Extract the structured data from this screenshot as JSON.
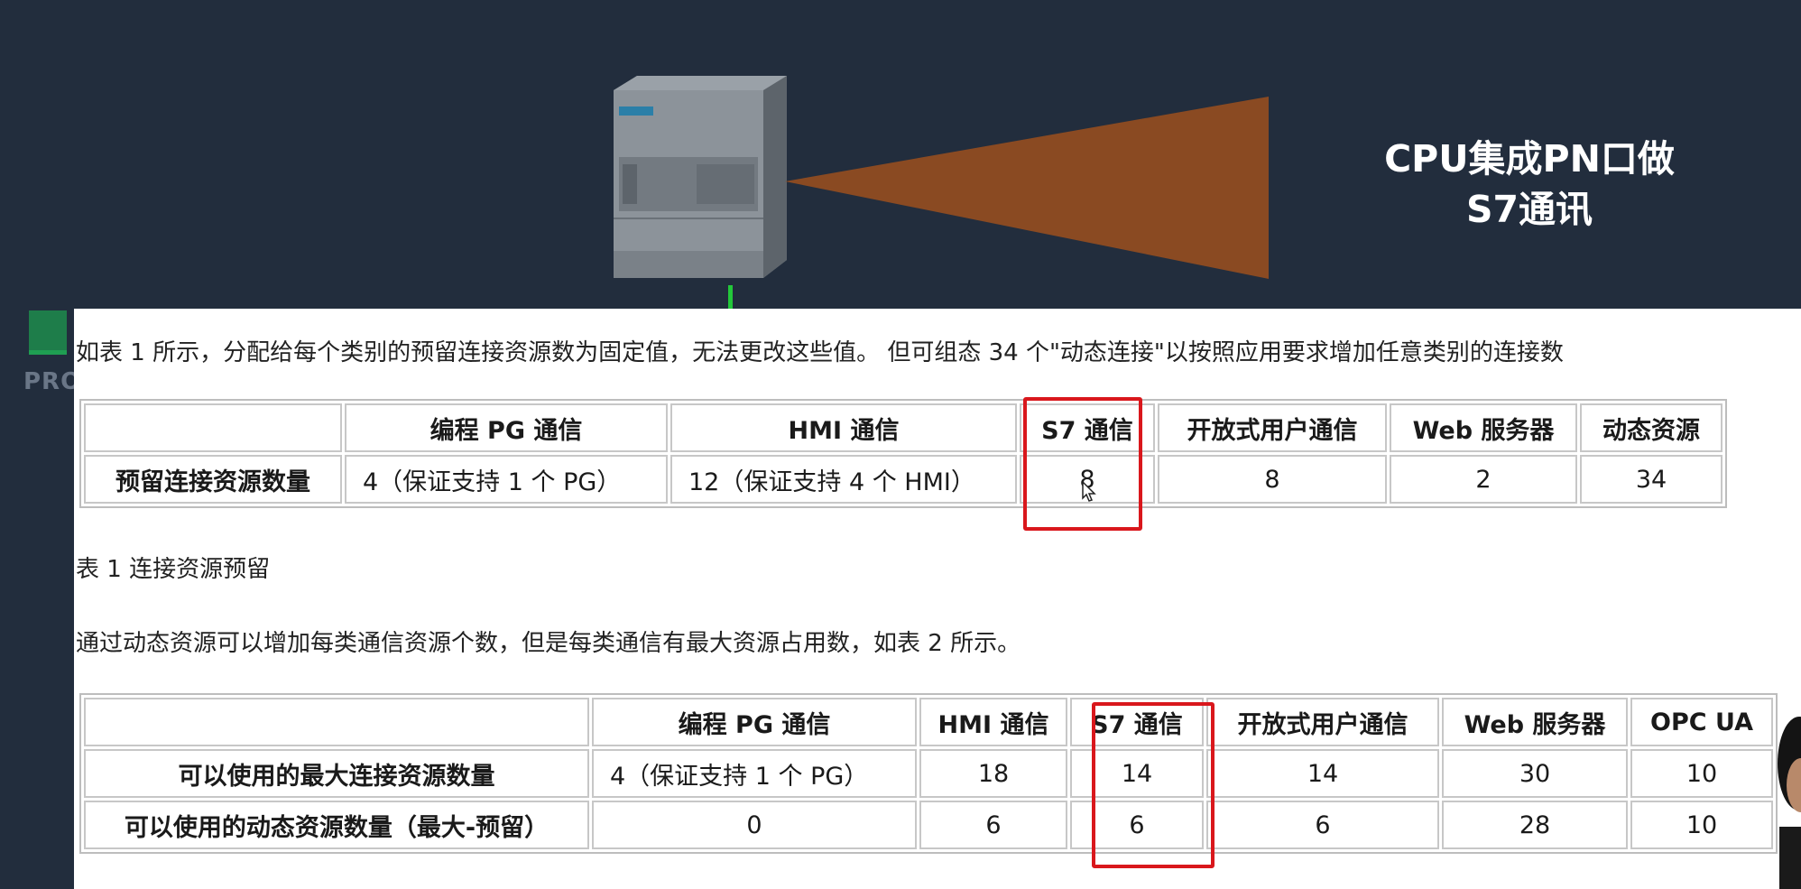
{
  "slide": {
    "title_line1": "CPU集成PN口做",
    "title_line2": "S7通讯",
    "side_label": "PRO"
  },
  "colors": {
    "background": "#222d3d",
    "cone": "#8a4a22",
    "highlight": "#d9171c",
    "wire": "#23c83a"
  },
  "doc": {
    "intro": "如表 1 所示，分配给每个类别的预留连接资源数为固定值，无法更改这些值。 但可组态 34 个\"动态连接\"以按照应用要求增加任意类别的连接数",
    "table1": {
      "headers": [
        "",
        "编程 PG 通信",
        "HMI 通信",
        "S7 通信",
        "开放式用户通信",
        "Web 服务器",
        "动态资源"
      ],
      "row": [
        "预留连接资源数量",
        "4（保证支持 1 个 PG）",
        "12（保证支持 4 个 HMI）",
        "8",
        "8",
        "2",
        "34"
      ]
    },
    "caption1": "表 1 连接资源预留",
    "para2": "通过动态资源可以增加每类通信资源个数，但是每类通信有最大资源占用数，如表 2 所示。",
    "table2": {
      "headers": [
        "",
        "编程 PG 通信",
        "HMI 通信",
        "S7 通信",
        "开放式用户通信",
        "Web 服务器",
        "OPC UA"
      ],
      "rows": [
        [
          "可以使用的最大连接资源数量",
          "4（保证支持 1 个 PG）",
          "18",
          "14",
          "14",
          "30",
          "10"
        ],
        [
          "可以使用的动态资源数量（最大-预留）",
          "0",
          "6",
          "6",
          "6",
          "28",
          "10"
        ]
      ]
    }
  }
}
